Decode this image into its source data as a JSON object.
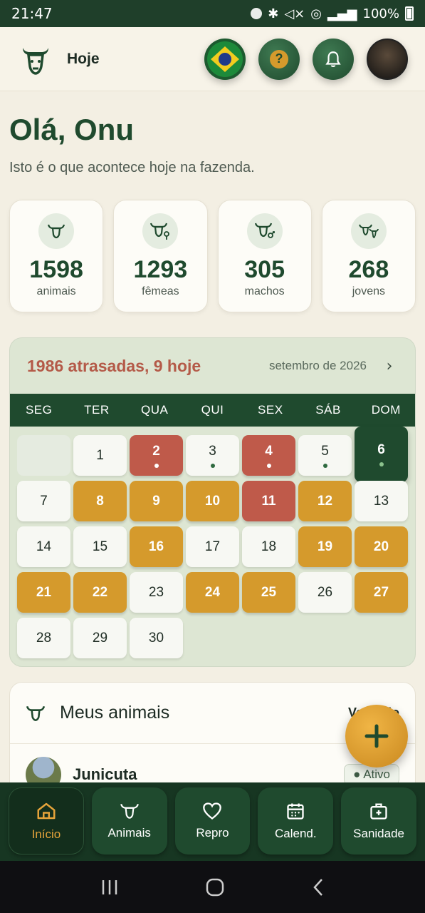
{
  "status_bar": {
    "time": "21:47",
    "battery": "100%"
  },
  "header": {
    "title": "Hoje"
  },
  "greeting": {
    "title": "Olá, Onu",
    "subtitle": "Isto é o que acontece hoje na fazenda."
  },
  "stats": [
    {
      "value": "1598",
      "label": "animais",
      "icon": "cow-icon"
    },
    {
      "value": "1293",
      "label": "fêmeas",
      "icon": "female-cow-icon"
    },
    {
      "value": "305",
      "label": "machos",
      "icon": "male-cow-icon"
    },
    {
      "value": "268",
      "label": "jovens",
      "icon": "calf-icon"
    }
  ],
  "calendar": {
    "summary": "1986 atrasadas, 9 hoje",
    "month": "setembro de 2026",
    "weekdays": [
      "SEG",
      "TER",
      "QUA",
      "QUI",
      "SEX",
      "SÁB",
      "DOM"
    ],
    "days": [
      {
        "label": "",
        "status": "empty"
      },
      {
        "label": "1",
        "status": "normal"
      },
      {
        "label": "2",
        "status": "red",
        "dot": "white"
      },
      {
        "label": "3",
        "status": "normal",
        "dot": "green"
      },
      {
        "label": "4",
        "status": "red",
        "dot": "white"
      },
      {
        "label": "5",
        "status": "normal",
        "dot": "green"
      },
      {
        "label": "6",
        "status": "today",
        "dot": "light"
      },
      {
        "label": "7",
        "status": "normal"
      },
      {
        "label": "8",
        "status": "orange"
      },
      {
        "label": "9",
        "status": "orange"
      },
      {
        "label": "10",
        "status": "orange"
      },
      {
        "label": "11",
        "status": "red"
      },
      {
        "label": "12",
        "status": "orange"
      },
      {
        "label": "13",
        "status": "normal"
      },
      {
        "label": "14",
        "status": "normal"
      },
      {
        "label": "15",
        "status": "normal"
      },
      {
        "label": "16",
        "status": "orange"
      },
      {
        "label": "17",
        "status": "normal"
      },
      {
        "label": "18",
        "status": "normal"
      },
      {
        "label": "19",
        "status": "orange"
      },
      {
        "label": "20",
        "status": "orange"
      },
      {
        "label": "21",
        "status": "orange"
      },
      {
        "label": "22",
        "status": "orange"
      },
      {
        "label": "23",
        "status": "normal"
      },
      {
        "label": "24",
        "status": "orange"
      },
      {
        "label": "25",
        "status": "orange"
      },
      {
        "label": "26",
        "status": "normal"
      },
      {
        "label": "27",
        "status": "orange"
      },
      {
        "label": "28",
        "status": "normal"
      },
      {
        "label": "29",
        "status": "normal"
      },
      {
        "label": "30",
        "status": "normal"
      }
    ]
  },
  "animals": {
    "title": "Meus animais",
    "see_all": "Ver todo",
    "first": {
      "name": "Junicuta",
      "status": "● Ativo"
    }
  },
  "nav": [
    {
      "label": "Início",
      "icon": "home-icon",
      "active": true
    },
    {
      "label": "Animais",
      "icon": "cow-icon",
      "active": false
    },
    {
      "label": "Repro",
      "icon": "heart-icon",
      "active": false
    },
    {
      "label": "Calend.",
      "icon": "calendar-icon",
      "active": false
    },
    {
      "label": "Sanidade",
      "icon": "medical-kit-icon",
      "active": false
    }
  ],
  "colors": {
    "primary": "#1f4a2e",
    "accent": "#d59a2c",
    "overdue": "#bf5a4a",
    "background": "#f3efe3"
  }
}
